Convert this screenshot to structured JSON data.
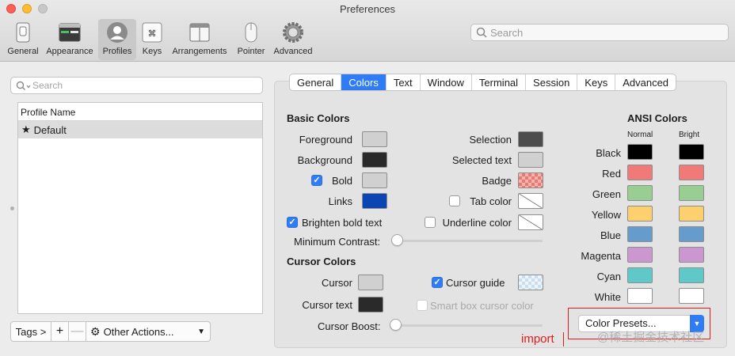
{
  "window": {
    "title": "Preferences"
  },
  "toolbar": {
    "items": [
      {
        "label": "General"
      },
      {
        "label": "Appearance"
      },
      {
        "label": "Profiles"
      },
      {
        "label": "Keys"
      },
      {
        "label": "Arrangements"
      },
      {
        "label": "Pointer"
      },
      {
        "label": "Advanced"
      }
    ],
    "search_placeholder": "Search"
  },
  "left": {
    "search_placeholder": "Search",
    "list_header": "Profile Name",
    "profiles": [
      {
        "name": "Default",
        "default": true
      }
    ],
    "tags_label": "Tags >",
    "add_label": "+",
    "remove_label": "—",
    "other_actions_label": "Other Actions..."
  },
  "tabs": [
    "General",
    "Colors",
    "Text",
    "Window",
    "Terminal",
    "Session",
    "Keys",
    "Advanced"
  ],
  "active_tab": "Colors",
  "basic": {
    "heading": "Basic Colors",
    "foreground": "Foreground",
    "background": "Background",
    "bold": "Bold",
    "links": "Links",
    "brighten": "Brighten bold text",
    "min_contrast": "Minimum Contrast:",
    "selection": "Selection",
    "selected_text": "Selected text",
    "badge": "Badge",
    "tab_color": "Tab color",
    "underline_color": "Underline color"
  },
  "cursor": {
    "heading": "Cursor Colors",
    "cursor": "Cursor",
    "cursor_text": "Cursor text",
    "cursor_boost": "Cursor Boost:",
    "cursor_guide": "Cursor guide",
    "smart_box": "Smart box cursor color"
  },
  "ansi": {
    "heading": "ANSI Colors",
    "normal": "Normal",
    "bright": "Bright",
    "rows": [
      {
        "name": "Black",
        "normal": "#000000",
        "bright": "#000000"
      },
      {
        "name": "Red",
        "normal": "#f07a78",
        "bright": "#f07a78"
      },
      {
        "name": "Green",
        "normal": "#98ce92",
        "bright": "#98ce92"
      },
      {
        "name": "Yellow",
        "normal": "#fcd06d",
        "bright": "#fcd06d"
      },
      {
        "name": "Blue",
        "normal": "#669bcd",
        "bright": "#669bcd"
      },
      {
        "name": "Magenta",
        "normal": "#cc97d1",
        "bright": "#cc97d1"
      },
      {
        "name": "Cyan",
        "normal": "#5fc9c9",
        "bright": "#5fc9c9"
      },
      {
        "name": "White",
        "normal": "#ffffff",
        "bright": "#ffffff"
      }
    ]
  },
  "presets": {
    "label": "Color Presets..."
  },
  "annotation": {
    "text": "import"
  },
  "watermark": "@稀土掘金技术社区",
  "colors": {
    "accent": "#2f7cf6",
    "foreground": "#d0d0d0",
    "background": "#2a2a2a",
    "bold": "#d0d0d0",
    "links": "#0b44b3",
    "selection": "#4d4d4d",
    "selected_text": "#d0d0d0",
    "cursor": "#d0d0d0",
    "cursor_text": "#2a2a2a",
    "annotation": "#e21b1b"
  }
}
